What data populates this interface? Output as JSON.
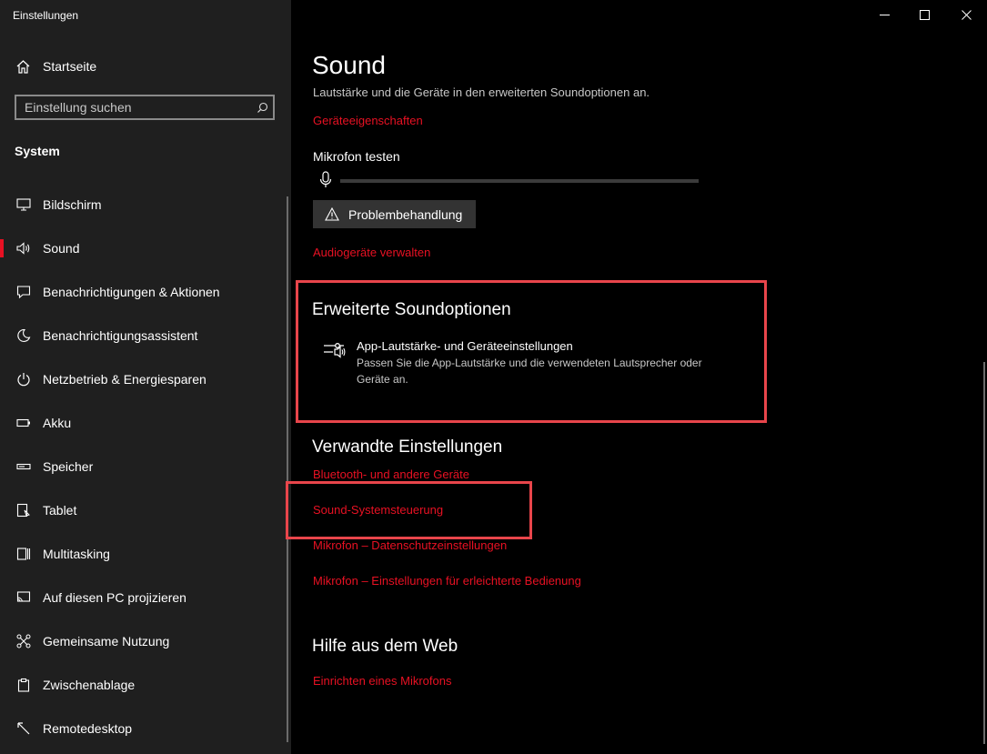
{
  "window": {
    "title": "Einstellungen"
  },
  "sidebar": {
    "home_label": "Startseite",
    "search_placeholder": "Einstellung suchen",
    "section": "System",
    "items": [
      {
        "label": "Bildschirm",
        "icon": "monitor-icon"
      },
      {
        "label": "Sound",
        "icon": "speaker-icon",
        "active": true
      },
      {
        "label": "Benachrichtigungen & Aktionen",
        "icon": "notification-icon"
      },
      {
        "label": "Benachrichtigungsassistent",
        "icon": "moon-icon"
      },
      {
        "label": "Netzbetrieb & Energiesparen",
        "icon": "power-icon"
      },
      {
        "label": "Akku",
        "icon": "battery-icon"
      },
      {
        "label": "Speicher",
        "icon": "storage-icon"
      },
      {
        "label": "Tablet",
        "icon": "tablet-icon"
      },
      {
        "label": "Multitasking",
        "icon": "multitasking-icon"
      },
      {
        "label": "Auf diesen PC projizieren",
        "icon": "project-icon"
      },
      {
        "label": "Gemeinsame Nutzung",
        "icon": "share-icon"
      },
      {
        "label": "Zwischenablage",
        "icon": "clipboard-icon"
      },
      {
        "label": "Remotedesktop",
        "icon": "remote-icon"
      }
    ]
  },
  "main": {
    "title": "Sound",
    "description": "Lautstärke und die Geräte in den erweiterten Soundoptionen an.",
    "device_properties_link": "Geräteeigenschaften",
    "mic_test_label": "Mikrofon testen",
    "mic_level": 0,
    "troubleshoot_button": "Problembehandlung",
    "manage_devices_link": "Audiogeräte verwalten",
    "advanced": {
      "heading": "Erweiterte Soundoptionen",
      "item_title": "App-Lautstärke- und Geräteeinstellungen",
      "item_desc": "Passen Sie die App-Lautstärke und die verwendeten Lautsprecher oder Geräte an."
    },
    "related": {
      "heading": "Verwandte Einstellungen",
      "links": [
        "Bluetooth- und andere Geräte",
        "Sound-Systemsteuerung",
        "Mikrofon – Datenschutzeinstellungen",
        "Mikrofon – Einstellungen für erleichterte Bedienung"
      ]
    },
    "help": {
      "heading": "Hilfe aus dem Web",
      "links": [
        "Einrichten eines Mikrofons"
      ]
    }
  },
  "colors": {
    "accent": "#e81123",
    "highlight": "#e8454b",
    "sidebar_bg": "#1f1f1f",
    "content_bg": "#000000"
  }
}
